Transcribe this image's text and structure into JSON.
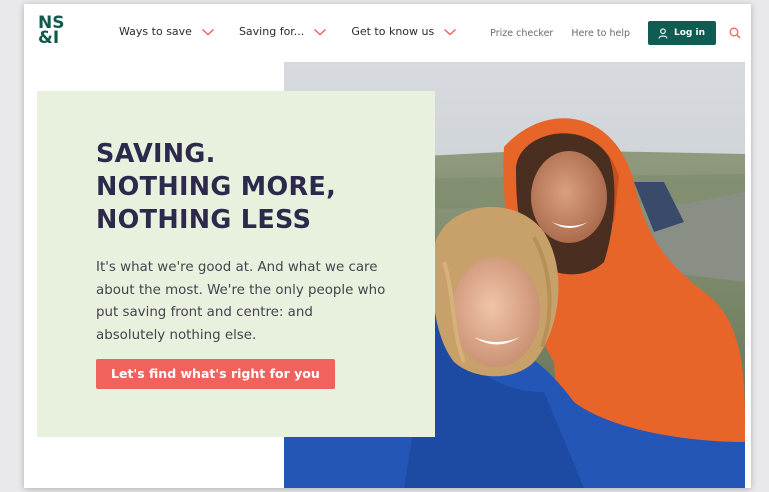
{
  "brand": {
    "logo_line1": "NS",
    "logo_line2": "&I"
  },
  "nav": {
    "items": [
      {
        "label": "Ways to save"
      },
      {
        "label": "Saving for..."
      },
      {
        "label": "Get to know us"
      }
    ]
  },
  "utility": {
    "prize_checker": "Prize checker",
    "here_to_help": "Here to help",
    "login": "Log in"
  },
  "hero": {
    "title_line1": "SAVING.",
    "title_line2": "NOTHING MORE,",
    "title_line3": "NOTHING LESS",
    "body": "It's what we're good at. And what we care about the most. We're the only people who put saving front and centre: and absolutely nothing else.",
    "cta": "Let's find what's right for you"
  },
  "colors": {
    "brand_green": "#0f5c52",
    "accent_coral": "#f0625c",
    "card_green": "#e7f1de",
    "title_navy": "#2b2a4c"
  },
  "icons": [
    "chevron-down-icon",
    "user-icon",
    "search-icon"
  ]
}
